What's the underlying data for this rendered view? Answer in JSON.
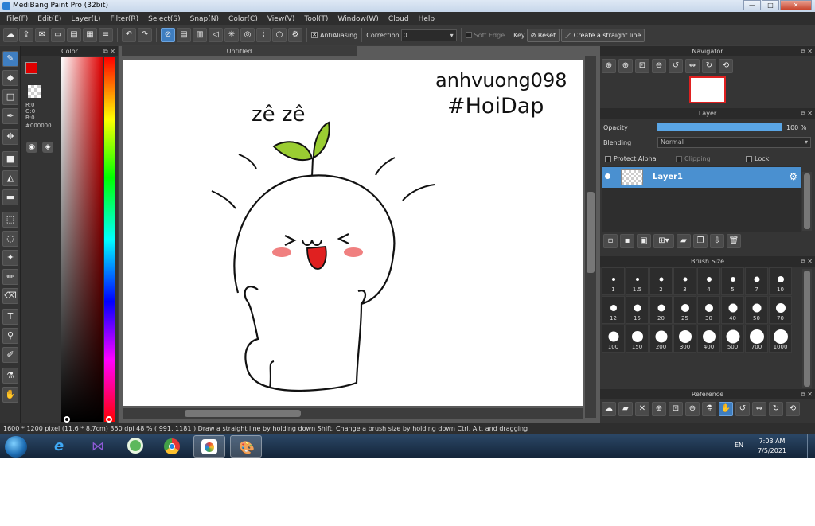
{
  "window": {
    "title": "MediBang Paint Pro (32bit)",
    "min": "—",
    "max": "□",
    "close": "✕"
  },
  "menu": [
    "File(F)",
    "Edit(E)",
    "Layer(L)",
    "Filter(R)",
    "Select(S)",
    "Snap(N)",
    "Color(C)",
    "View(V)",
    "Tool(T)",
    "Window(W)",
    "Cloud",
    "Help"
  ],
  "toolbar": {
    "antialiasing": "AntiAliasing",
    "correction_label": "Correction",
    "correction_value": "0",
    "soft_edge": "Soft Edge",
    "key": "Key",
    "reset": "Reset",
    "straight_line": "Create a straight line"
  },
  "color_panel": {
    "title": "Color",
    "r": "R:0",
    "g": "G:0",
    "b": "B:0",
    "hex": "#000000",
    "fg": "#e00000",
    "bg": "#000000"
  },
  "document": {
    "tab": "Untitled"
  },
  "canvas_text": {
    "handwriting1": "anhvuong098",
    "handwriting2": "#HoiDap",
    "onomatopoeia": "zê zê"
  },
  "navigator": {
    "title": "Navigator"
  },
  "layer_panel": {
    "title": "Layer",
    "opacity_label": "Opacity",
    "opacity_value": "100 %",
    "opacity_fraction": 1.0,
    "blending_label": "Blending",
    "blending_value": "Normal",
    "protect_alpha": "Protect Alpha",
    "clipping": "Clipping",
    "lock": "Lock",
    "layers": [
      {
        "name": "Layer1"
      }
    ]
  },
  "brush_size": {
    "title": "Brush Size",
    "sizes": [
      "1",
      "1.5",
      "2",
      "3",
      "4",
      "5",
      "7",
      "10",
      "12",
      "15",
      "20",
      "25",
      "30",
      "40",
      "50",
      "70",
      "100",
      "150",
      "200",
      "300",
      "400",
      "500",
      "700",
      "1000"
    ]
  },
  "reference": {
    "title": "Reference"
  },
  "status": {
    "text": "1600 * 1200 pixel   (11.6 * 8.7cm)  350 dpi   48 %   ( 991, 1181 )   Draw a straight line by holding down Shift, Change a brush size by holding down Ctrl, Alt, and dragging"
  },
  "taskbar": {
    "lang": "EN",
    "time": "7:03 AM",
    "date": "7/5/2021"
  }
}
